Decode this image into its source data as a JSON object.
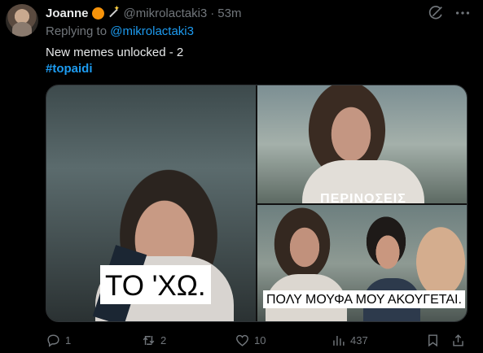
{
  "user": {
    "name": "Joanne",
    "handle": "@mikrolactaki3",
    "separator": "·",
    "time": "53m"
  },
  "replying": {
    "prefix": "Replying to",
    "mention": "@mikrolactaki3"
  },
  "tweet": {
    "text": "New memes unlocked - 2",
    "hashtag": "#topaidi"
  },
  "media": {
    "caption_left": "ΤΟ 'ΧΩ.",
    "caption_right_bottom": "ΠΟΛΥ ΜΟΥΦΑ ΜΟΥ ΑΚΟΥΓΕΤΑΙ.",
    "caption_right_top_partial": "ΠΕΡΙΝΟΣΕΙΣ"
  },
  "actions": {
    "replies": "1",
    "reposts": "2",
    "likes": "10",
    "views": "437"
  },
  "icons": [
    "avatar",
    "orange-circle-icon",
    "magic-wand-icon",
    "grok-icon",
    "more-icon",
    "reply-icon",
    "repost-icon",
    "like-icon",
    "views-icon",
    "bookmark-icon",
    "share-icon"
  ],
  "colors": {
    "background": "#000000",
    "text": "#e7e9ea",
    "secondary": "#71767b",
    "accent": "#1d9bf0"
  }
}
